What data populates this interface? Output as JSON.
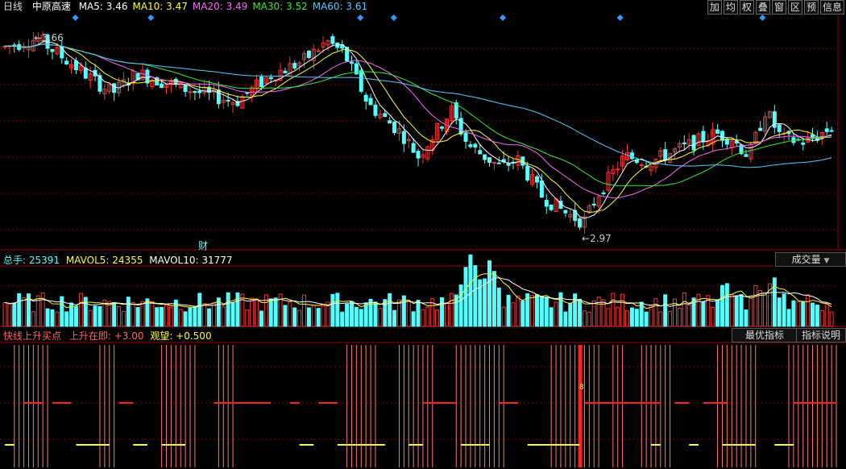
{
  "header": {
    "period_label": "日线",
    "stock_name": "中原高速",
    "ma": [
      {
        "label": "MA5: 3.46",
        "color": "#ffffff"
      },
      {
        "label": "MA10: 3.47",
        "color": "#ffff33"
      },
      {
        "label": "MA20: 3.49",
        "color": "#ff66ff"
      },
      {
        "label": "MA30: 3.52",
        "color": "#33ee33"
      },
      {
        "label": "MA60: 3.61",
        "color": "#55ccff"
      }
    ]
  },
  "toolbar": [
    "加",
    "均",
    "权",
    "叠",
    "窗",
    "区",
    "预",
    "信息"
  ],
  "price_panel": {
    "high_label": "3.66",
    "low_label": "2.97",
    "event_marker": "财",
    "diamond_positions": [
      0.09,
      0.18,
      0.43,
      0.47,
      0.6,
      0.74,
      0.91
    ]
  },
  "volume_panel": {
    "total_label": "总手: 25391",
    "mavol5_label": "MAVOL5: 24355",
    "mavol10_label": "MAVOL10: 31777",
    "type_select": "成交量"
  },
  "indicator_panel": {
    "title": "快线上升买点",
    "rise_label": "上升在即: +3.00",
    "watch_label": "观望: +0.500",
    "best_button": "最优指标",
    "explain_button": "指标说明",
    "marker_value": "8"
  },
  "colors": {
    "up": "#ff3333",
    "down": "#54ffff",
    "grid": "#800000",
    "panel_border": "#a00000"
  }
}
